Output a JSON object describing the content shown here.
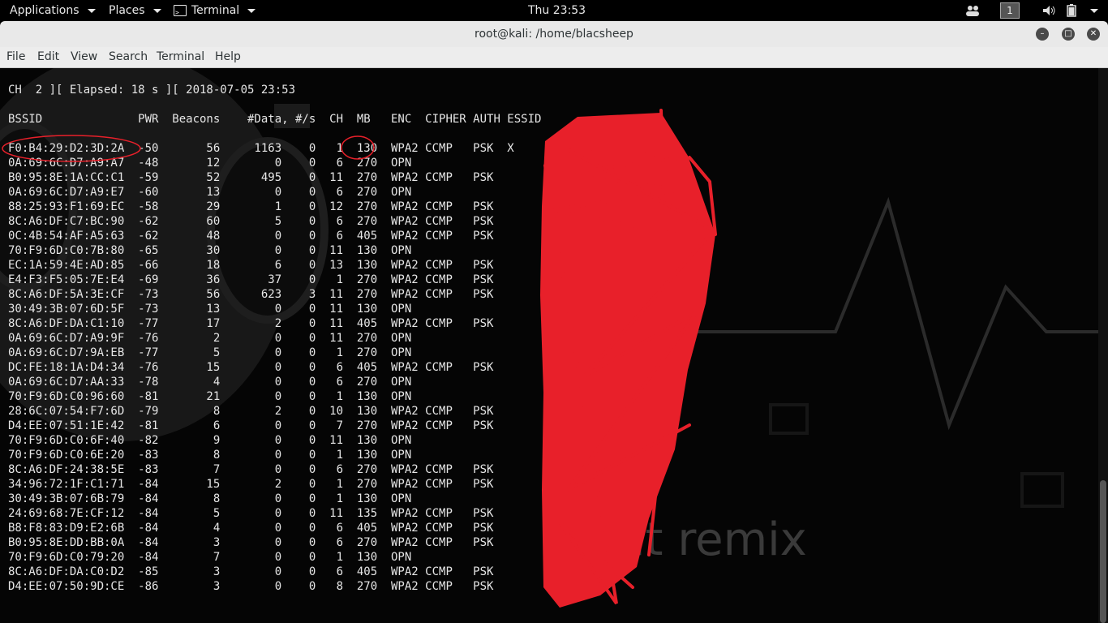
{
  "topbar": {
    "applications": "Applications",
    "places": "Places",
    "terminal": "Terminal",
    "clock": "Thu 23:53",
    "workspace": "1"
  },
  "window": {
    "title": "root@kali: /home/blacsheep",
    "menu": [
      "File",
      "Edit",
      "View",
      "Search",
      "Terminal",
      "Help"
    ]
  },
  "terminal": {
    "status_line": "CH  2 ][ Elapsed: 18 s ][ 2018-07-05 23:53",
    "header_line": "BSSID              PWR  Beacons    #Data, #/s  CH  MB   ENC  CIPHER AUTH ESSID",
    "background_text": "it remix",
    "rows": [
      "F0:B4:29:D2:3D:2A  -50       56     1163    0   1  130  WPA2 CCMP   PSK  X",
      "0A:69:6C:D7:A9:A7  -48       12        0    0   6  270  OPN",
      "B0:95:8E:1A:CC:C1  -59       52      495    0  11  270  WPA2 CCMP   PSK",
      "0A:69:6C:D7:A9:E7  -60       13        0    0   6  270  OPN",
      "88:25:93:F1:69:EC  -58       29        1    0  12  270  WPA2 CCMP   PSK",
      "8C:A6:DF:C7:BC:90  -62       60        5    0   6  270  WPA2 CCMP   PSK",
      "0C:4B:54:AF:A5:63  -62       48        0    0   6  405  WPA2 CCMP   PSK",
      "70:F9:6D:C0:7B:80  -65       30        0    0  11  130  OPN",
      "EC:1A:59:4E:AD:85  -66       18        6    0  13  130  WPA2 CCMP   PSK",
      "E4:F3:F5:05:7E:E4  -69       36       37    0   1  270  WPA2 CCMP   PSK",
      "8C:A6:DF:5A:3E:CF  -73       56      623    3  11  270  WPA2 CCMP   PSK",
      "30:49:3B:07:6D:5F  -73       13        0    0  11  130  OPN",
      "8C:A6:DF:DA:C1:10  -77       17        2    0  11  405  WPA2 CCMP   PSK",
      "0A:69:6C:D7:A9:9F  -76        2        0    0  11  270  OPN",
      "0A:69:6C:D7:9A:EB  -77        5        0    0   1  270  OPN",
      "DC:FE:18:1A:D4:34  -76       15        0    0   6  405  WPA2 CCMP   PSK",
      "0A:69:6C:D7:AA:33  -78        4        0    0   6  270  OPN",
      "70:F9:6D:C0:96:60  -81       21        0    0   1  130  OPN",
      "28:6C:07:54:F7:6D  -79        8        2    0  10  130  WPA2 CCMP   PSK",
      "D4:EE:07:51:1E:42  -81        6        0    0   7  270  WPA2 CCMP   PSK",
      "70:F9:6D:C0:6F:40  -82        9        0    0  11  130  OPN",
      "70:F9:6D:C0:6E:20  -83        8        0    0   1  130  OPN",
      "8C:A6:DF:24:38:5E  -83        7        0    0   6  270  WPA2 CCMP   PSK",
      "34:96:72:1F:C1:71  -84       15        2    0   1  270  WPA2 CCMP   PSK",
      "30:49:3B:07:6B:79  -84        8        0    0   1  130  OPN",
      "24:69:68:7E:CF:12  -84        5        0    0  11  135  WPA2 CCMP   PSK",
      "B8:F8:83:D9:E2:6B  -84        4        0    0   6  405  WPA2 CCMP   PSK",
      "B0:95:8E:DD:BB:0A  -84        3        0    0   6  270  WPA2 CCMP   PSK",
      "70:F9:6D:C0:79:20  -84        7        0    0   1  130  OPN",
      "8C:A6:DF:DA:C0:D2  -85        3        0    0   6  405  WPA2 CCMP   PSK",
      "D4:EE:07:50:9D:CE  -86        3        0    0   8  270  WPA2 CCMP   PSK"
    ]
  },
  "colors": {
    "redaction": "#e8202a",
    "terminal_text": "#e6e6e6",
    "terminal_bg": "#050505"
  }
}
